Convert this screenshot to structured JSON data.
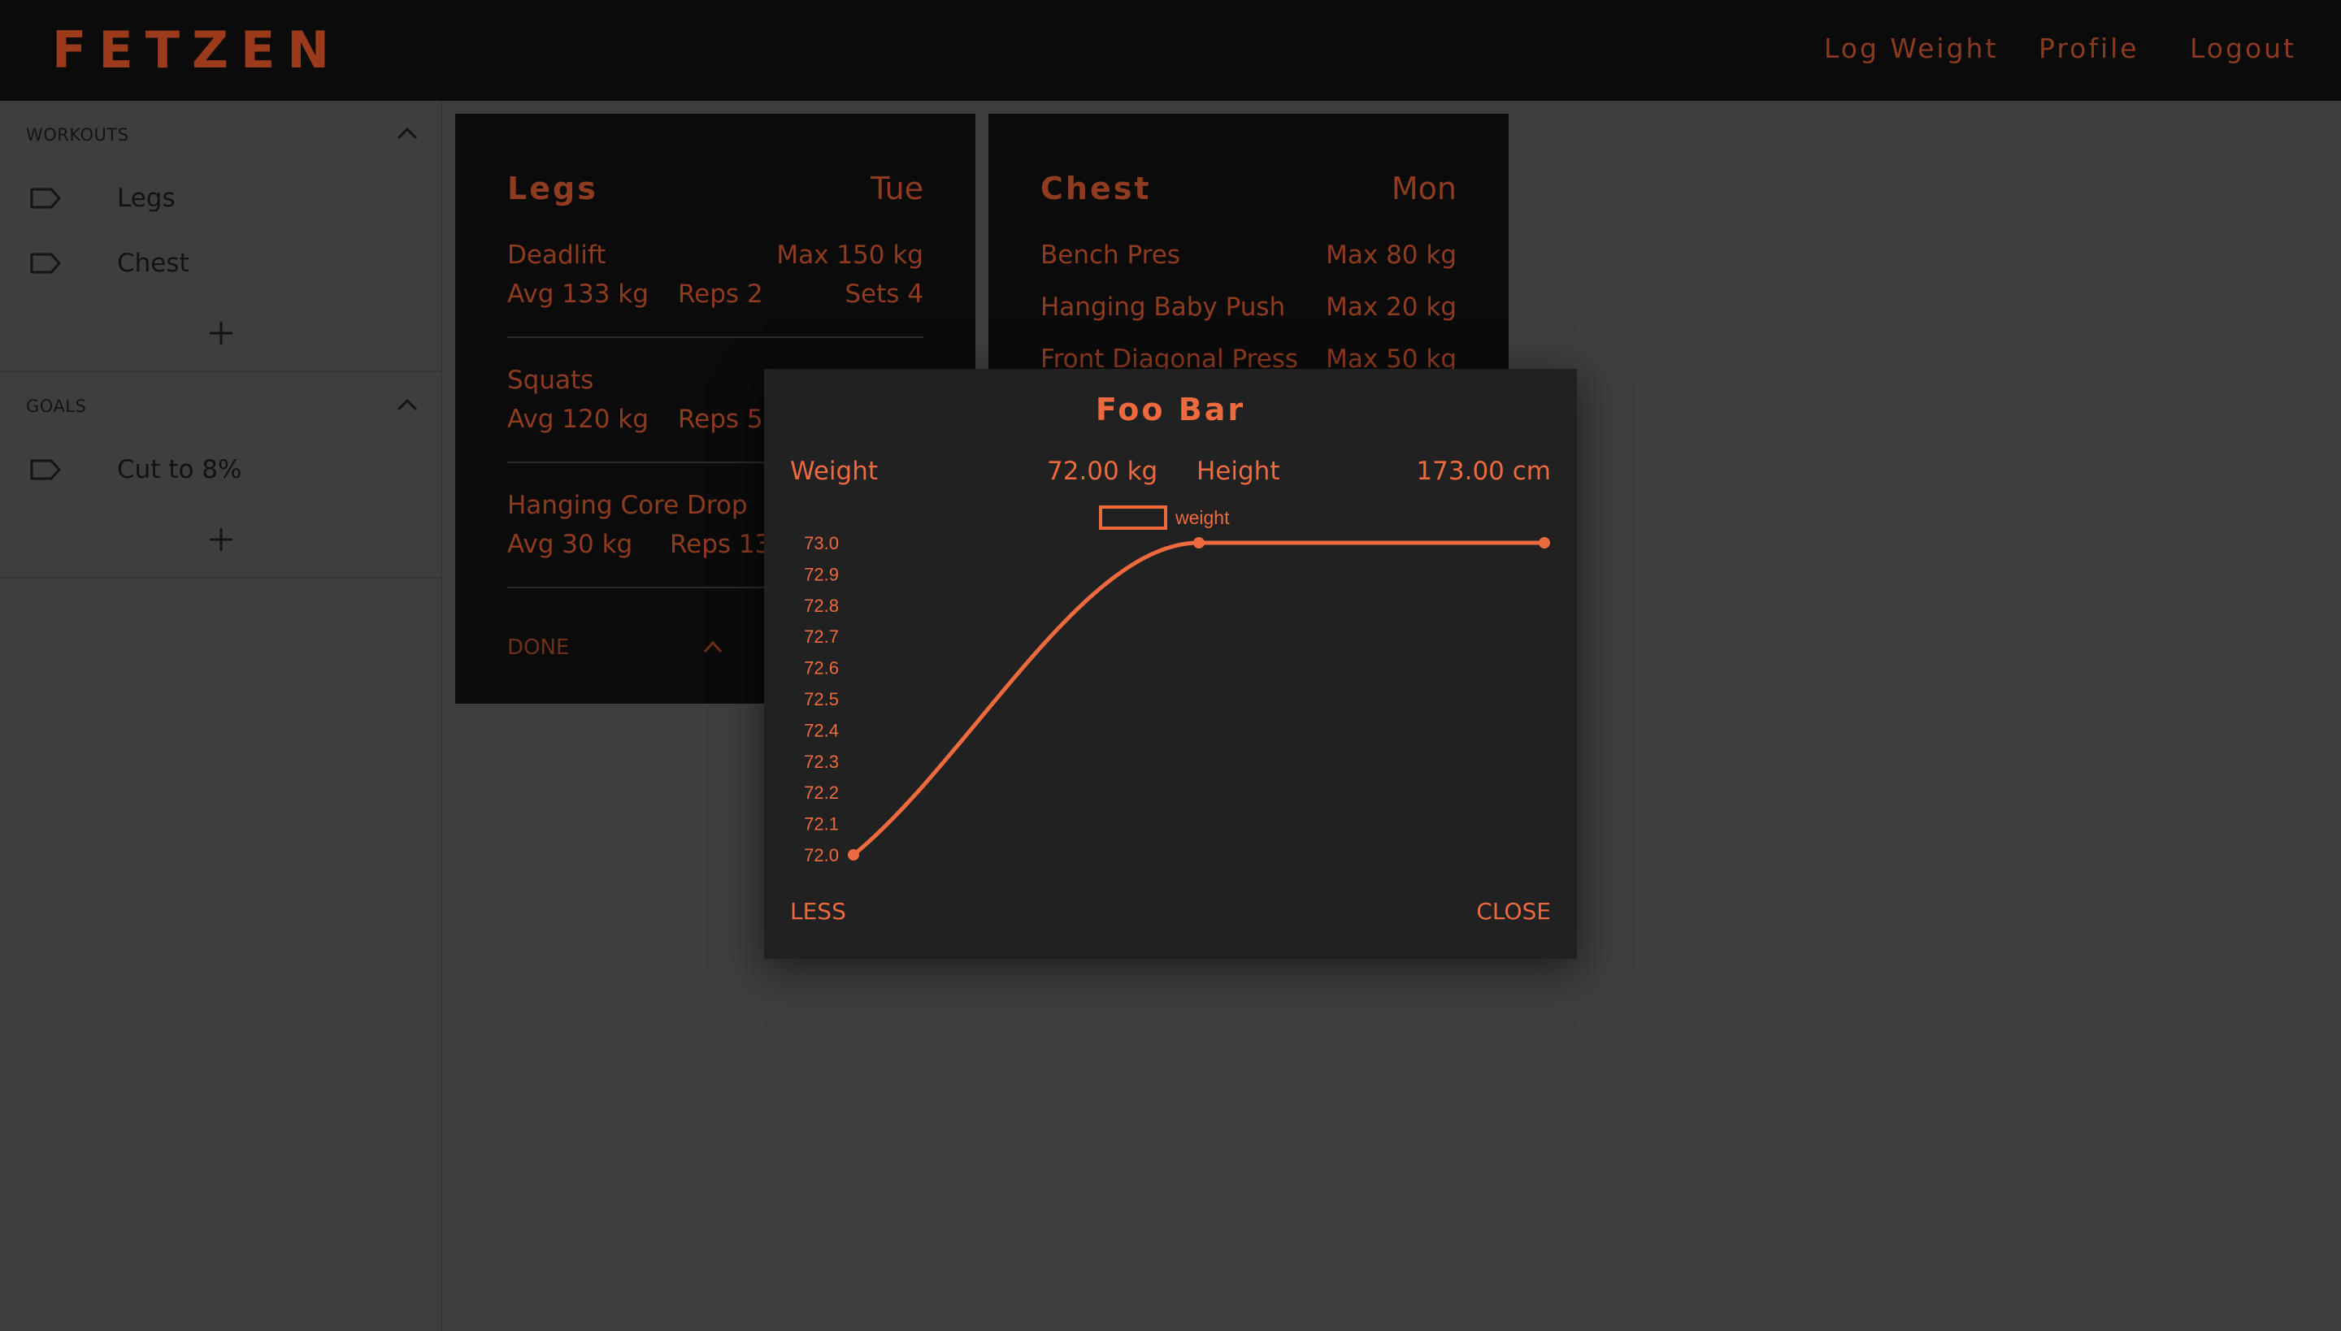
{
  "header": {
    "logo": "FETZEN",
    "nav": [
      "Log Weight",
      "Profile",
      "Logout"
    ]
  },
  "sidebar": {
    "workouts_title": "WORKOUTS",
    "workouts": [
      "Legs",
      "Chest"
    ],
    "goals_title": "GOALS",
    "goals": [
      "Cut to 8%"
    ]
  },
  "cards": {
    "legs": {
      "title": "Legs",
      "day": "Tue",
      "exercises": [
        {
          "name": "Deadlift",
          "max": "Max 150 kg",
          "avg": "Avg 133 kg",
          "reps": "Reps 2",
          "sets": "Sets 4"
        },
        {
          "name": "Squats",
          "avg": "Avg 120 kg",
          "reps": "Reps 5"
        },
        {
          "name": "Hanging Core Drop",
          "avg": "Avg 30 kg",
          "reps": "Reps 13"
        }
      ],
      "done_label": "DONE"
    },
    "chest": {
      "title": "Chest",
      "day": "Mon",
      "exercises": [
        {
          "name": "Bench Pres",
          "max": "Max 80 kg"
        },
        {
          "name": "Hanging Baby Push",
          "max": "Max 20 kg"
        },
        {
          "name": "Front Diagonal Press",
          "max": "Max 50 kg"
        }
      ]
    }
  },
  "modal": {
    "title": "Foo Bar",
    "weight_label": "Weight",
    "weight_value": "72.00 kg",
    "height_label": "Height",
    "height_value": "173.00 cm",
    "less_label": "LESS",
    "close_label": "CLOSE"
  },
  "colors": {
    "accent": "#ec6a3e",
    "accent_dim": "#8e3b1f",
    "topbar_bg": "#0b0b0b",
    "page_bg": "#3e3e3e",
    "modal_bg": "#212121"
  },
  "chart_data": {
    "type": "line",
    "series": [
      {
        "name": "weight",
        "values": [
          72.0,
          73.0,
          73.0
        ]
      }
    ],
    "ylim": [
      72.0,
      73.0
    ],
    "yticks": [
      "73.0",
      "72.9",
      "72.8",
      "72.7",
      "72.6",
      "72.5",
      "72.4",
      "72.3",
      "72.2",
      "72.1",
      "72.0"
    ],
    "legend": "top-center",
    "color": "#ec6a3e"
  }
}
